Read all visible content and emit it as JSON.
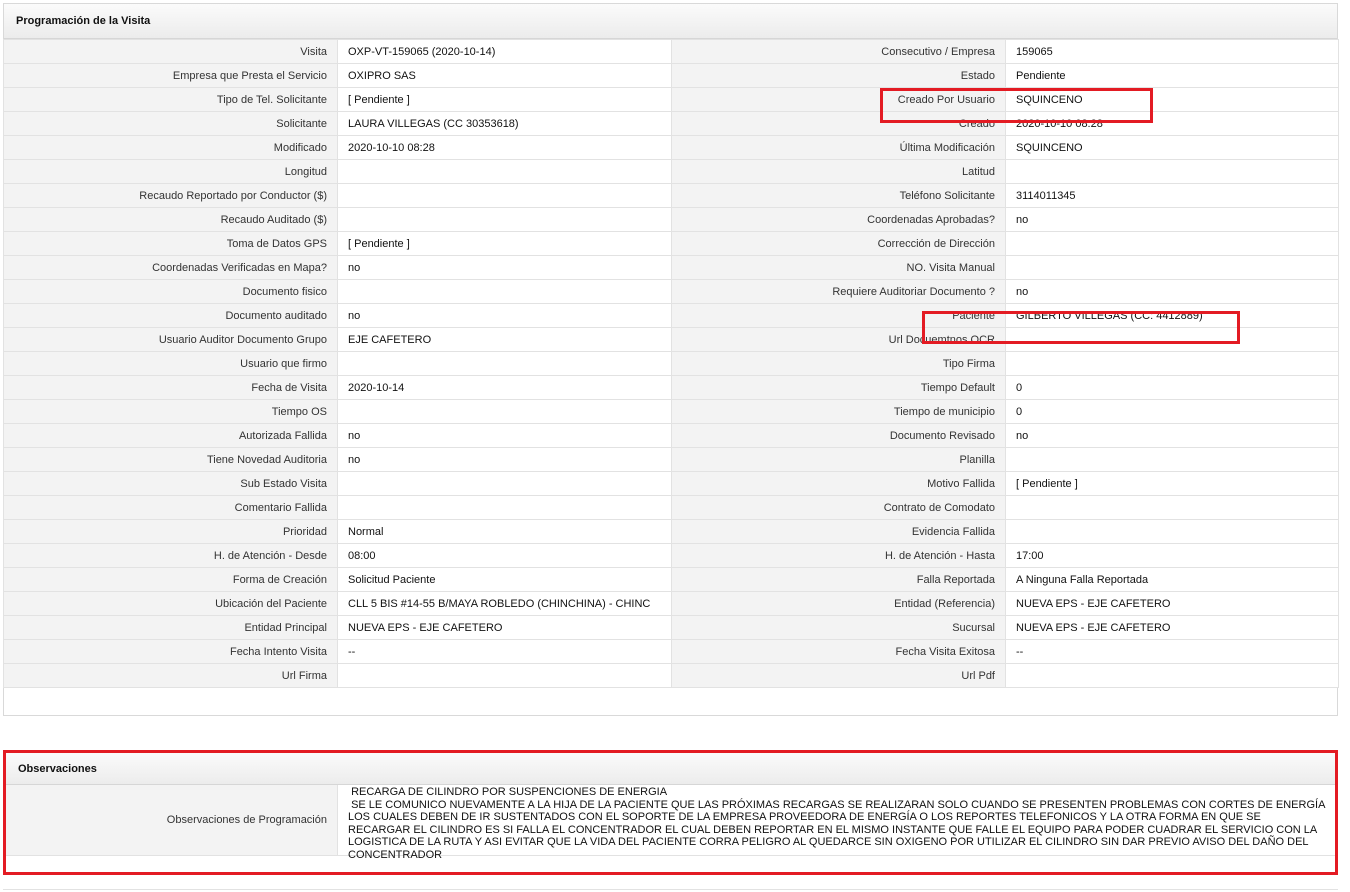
{
  "section_title": "Programación de la Visita",
  "rows": [
    {
      "l1": "Visita",
      "v1": "OXP-VT-159065 (2020-10-14)",
      "l2": "Consecutivo / Empresa",
      "v2": "159065"
    },
    {
      "l1": "Empresa que Presta el Servicio",
      "v1": "OXIPRO SAS",
      "l2": "Estado",
      "v2": "Pendiente"
    },
    {
      "l1": "Tipo de Tel. Solicitante",
      "v1": "[ Pendiente ]",
      "l2": "Creado Por Usuario",
      "v2": "SQUINCENO"
    },
    {
      "l1": "Solicitante",
      "v1": "LAURA VILLEGAS (CC 30353618)",
      "l2": "Creado",
      "v2": "2020-10-10 08:28"
    },
    {
      "l1": "Modificado",
      "v1": "2020-10-10 08:28",
      "l2": "Última Modificación",
      "v2": " SQUINCENO"
    },
    {
      "l1": "Longitud",
      "v1": "",
      "l2": "Latitud",
      "v2": ""
    },
    {
      "l1": "Recaudo Reportado por Conductor ($)",
      "v1": "",
      "l2": "Teléfono Solicitante",
      "v2": "3114011345"
    },
    {
      "l1": "Recaudo Auditado ($)",
      "v1": "",
      "l2": "Coordenadas Aprobadas?",
      "v2": " no"
    },
    {
      "l1": "Toma de Datos GPS",
      "v1": "[ Pendiente ]",
      "l2": "Corrección de Dirección",
      "v2": ""
    },
    {
      "l1": "Coordenadas Verificadas en Mapa?",
      "v1": " no",
      "l2": "NO. Visita Manual",
      "v2": ""
    },
    {
      "l1": "Documento fisico",
      "v1": "",
      "l2": "Requiere Auditoriar Documento ?",
      "v2": " no"
    },
    {
      "l1": "Documento auditado",
      "v1": " no",
      "l2": "Paciente",
      "v2": "GILBERTO VILLEGAS (CC: 4412889)"
    },
    {
      "l1": "Usuario Auditor Documento Grupo",
      "v1": "EJE CAFETERO",
      "l2": "Url Docuemtnos OCR",
      "v2": ""
    },
    {
      "l1": "Usuario que firmo",
      "v1": "",
      "l2": "Tipo Firma",
      "v2": ""
    },
    {
      "l1": "Fecha de Visita",
      "v1": " 2020-10-14",
      "l2": "Tiempo Default",
      "v2": "0"
    },
    {
      "l1": "Tiempo OS",
      "v1": "",
      "l2": "Tiempo de municipio",
      "v2": "0"
    },
    {
      "l1": "Autorizada Fallida",
      "v1": " no",
      "l2": "Documento Revisado",
      "v2": " no"
    },
    {
      "l1": "Tiene Novedad Auditoria",
      "v1": " no",
      "l2": "Planilla",
      "v2": ""
    },
    {
      "l1": "Sub Estado Visita",
      "v1": "",
      "l2": "Motivo Fallida",
      "v2": "[ Pendiente ]"
    },
    {
      "l1": "Comentario Fallida",
      "v1": "",
      "l2": "Contrato de Comodato",
      "v2": ""
    },
    {
      "l1": "Prioridad",
      "v1": "Normal",
      "l2": "Evidencia Fallida",
      "v2": ""
    },
    {
      "l1": "H. de Atención - Desde",
      "v1": "08:00",
      "l2": "H. de Atención - Hasta",
      "v2": "17:00"
    },
    {
      "l1": "Forma de Creación",
      "v1": "Solicitud Paciente",
      "l2": "Falla Reportada",
      "v2": "A Ninguna Falla Reportada"
    },
    {
      "l1": "Ubicación del Paciente",
      "v1": "CLL 5 BIS #14-55 B/MAYA ROBLEDO (CHINCHINA) - CHINC",
      "l2": "Entidad (Referencia)",
      "v2": "NUEVA EPS - EJE CAFETERO"
    },
    {
      "l1": "Entidad Principal",
      "v1": "NUEVA EPS - EJE CAFETERO",
      "l2": "Sucursal",
      "v2": "NUEVA EPS - EJE CAFETERO"
    },
    {
      "l1": "Fecha Intento Visita",
      "v1": " --",
      "l2": "Fecha Visita Exitosa",
      "v2": " --"
    },
    {
      "l1": "Url Firma",
      "v1": "",
      "l2": "Url Pdf",
      "v2": ""
    }
  ],
  "observaciones": {
    "title": "Observaciones",
    "label": "Observaciones de Programación",
    "text": " RECARGA DE CILINDRO POR SUSPENCIONES DE ENERGIA\n SE LE COMUNICO NUEVAMENTE A LA HIJA DE LA PACIENTE QUE LAS PRÓXIMAS RECARGAS SE REALIZARAN SOLO CUANDO SE PRESENTEN PROBLEMAS CON CORTES DE ENERGÍA LOS CUALES DEBEN DE IR SUSTENTADOS CON EL SOPORTE DE LA EMPRESA PROVEEDORA DE ENERGÍA O LOS REPORTES TELEFONICOS Y LA OTRA FORMA EN QUE SE RECARGAR EL CILINDRO ES SI FALLA EL CONCENTRADOR EL CUAL DEBEN REPORTAR EN EL MISMO INSTANTE QUE FALLE EL EQUIPO PARA PODER CUADRAR EL SERVICIO CON LA LOGISTICA DE LA RUTA Y ASI EVITAR QUE LA VIDA DEL PACIENTE CORRA PELIGRO AL QUEDARCE SIN OXIGENO POR UTILIZAR EL CILINDRO SIN DAR PREVIO AVISO DEL DAÑO DEL CONCENTRADOR"
  },
  "colors": {
    "highlight": "#e31b23",
    "label_bg": "#f3f3f3",
    "border": "#e2e2e2"
  }
}
